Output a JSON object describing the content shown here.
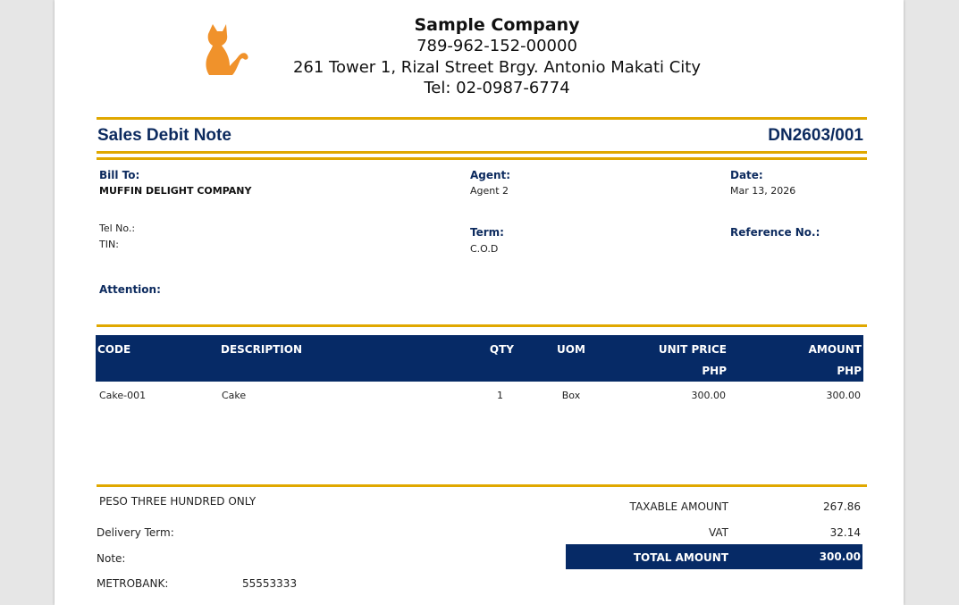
{
  "company": {
    "name": "Sample Company",
    "tin": "789-962-152-00000",
    "address": "261 Tower 1, Rizal Street Brgy. Antonio Makati City",
    "tel": "Tel: 02-0987-6774"
  },
  "logo_icon": "cat-icon",
  "accent_color": "#e0a800",
  "navy_color": "#062a66",
  "document": {
    "title": "Sales Debit Note",
    "number": "DN2603/001"
  },
  "bill_to": {
    "label": "Bill To:",
    "value": "MUFFIN DELIGHT COMPANY"
  },
  "tel": {
    "label": "Tel No.:",
    "value": ""
  },
  "tin": {
    "label": "TIN:",
    "value": ""
  },
  "attention": {
    "label": "Attention:",
    "value": ""
  },
  "agent": {
    "label": "Agent:",
    "value": "Agent 2"
  },
  "term": {
    "label": "Term:",
    "value": "C.O.D"
  },
  "date": {
    "label": "Date:",
    "value": "Mar 13, 2026"
  },
  "reference": {
    "label": "Reference No.:",
    "value": ""
  },
  "table": {
    "headers": {
      "code": "CODE",
      "description": "DESCRIPTION",
      "qty": "QTY",
      "uom": "UOM",
      "unit_price": "UNIT PRICE",
      "unit_price_currency": "PHP",
      "amount": "AMOUNT",
      "amount_currency": "PHP"
    },
    "rows": [
      {
        "code": "Cake-001",
        "description": "Cake",
        "qty": "1",
        "uom": "Box",
        "unit_price": "300.00",
        "amount": "300.00"
      }
    ]
  },
  "amount_in_words": "PESO THREE HUNDRED  ONLY",
  "delivery_term": {
    "label": "Delivery Term:",
    "value": ""
  },
  "note": {
    "label": "Note:",
    "value": ""
  },
  "bank": {
    "label": "METROBANK:",
    "value": "55553333"
  },
  "totals": {
    "taxable_label": "TAXABLE AMOUNT",
    "taxable_value": "267.86",
    "vat_label": "VAT",
    "vat_value": "32.14",
    "total_label": "TOTAL AMOUNT",
    "total_value": "300.00"
  }
}
